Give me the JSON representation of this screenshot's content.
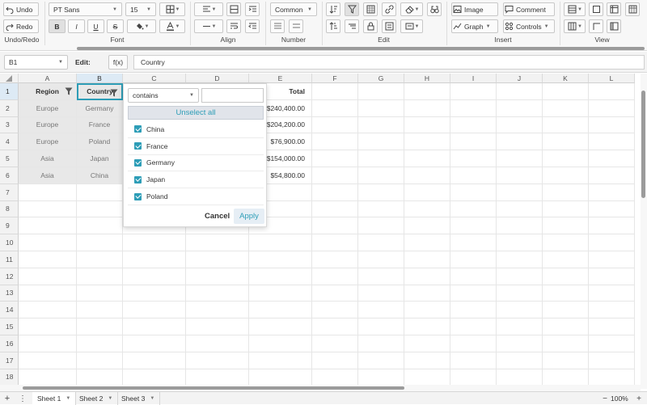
{
  "toolbar": {
    "undo": "Undo",
    "redo": "Redo",
    "font_name": "PT Sans",
    "font_size": "15",
    "bold": "B",
    "italic": "I",
    "underline": "U",
    "strike": "S",
    "number_format": "Common",
    "image": "Image",
    "comment": "Comment",
    "graph": "Graph",
    "controls": "Controls",
    "groups": {
      "undo_redo": "Undo/Redo",
      "font": "Font",
      "align": "Align",
      "number": "Number",
      "edit": "Edit",
      "insert": "Insert",
      "view": "View"
    }
  },
  "formula_bar": {
    "cell_ref": "B1",
    "edit_label": "Edit:",
    "fx": "f(x)",
    "value": "Country"
  },
  "columns": [
    "A",
    "B",
    "C",
    "D",
    "E",
    "F",
    "G",
    "H",
    "I",
    "J",
    "K",
    "L"
  ],
  "rows": [
    "1",
    "2",
    "3",
    "4",
    "5",
    "6",
    "7",
    "8",
    "9",
    "10",
    "11",
    "12",
    "13",
    "14",
    "15",
    "16",
    "17",
    "18"
  ],
  "cells": {
    "A1": "Region",
    "B1": "Country",
    "E1": "Total",
    "A2": "Europe",
    "B2": "Germany",
    "E2": "$240,400.00",
    "A3": "Europe",
    "B3": "France",
    "E3": "$204,200.00",
    "A4": "Europe",
    "B4": "Poland",
    "E4": "$76,900.00",
    "A5": "Asia",
    "B5": "Japan",
    "E5": "$154,000.00",
    "A6": "Asia",
    "B6": "China",
    "E6": "$54,800.00"
  },
  "filter_popup": {
    "condition": "contains",
    "search_value": "",
    "unselect_all": "Unselect all",
    "items": [
      {
        "label": "China",
        "checked": true
      },
      {
        "label": "France",
        "checked": true
      },
      {
        "label": "Germany",
        "checked": true
      },
      {
        "label": "Japan",
        "checked": true
      },
      {
        "label": "Poland",
        "checked": true
      }
    ],
    "cancel": "Cancel",
    "apply": "Apply"
  },
  "sheets": [
    "Sheet 1",
    "Sheet 2",
    "Sheet 3"
  ],
  "active_sheet": "Sheet 1",
  "zoom": "100%",
  "colors": {
    "accent": "#2d9db7",
    "selected_header": "#ddeaf5",
    "filtered_cells": "#e8e8e8"
  }
}
